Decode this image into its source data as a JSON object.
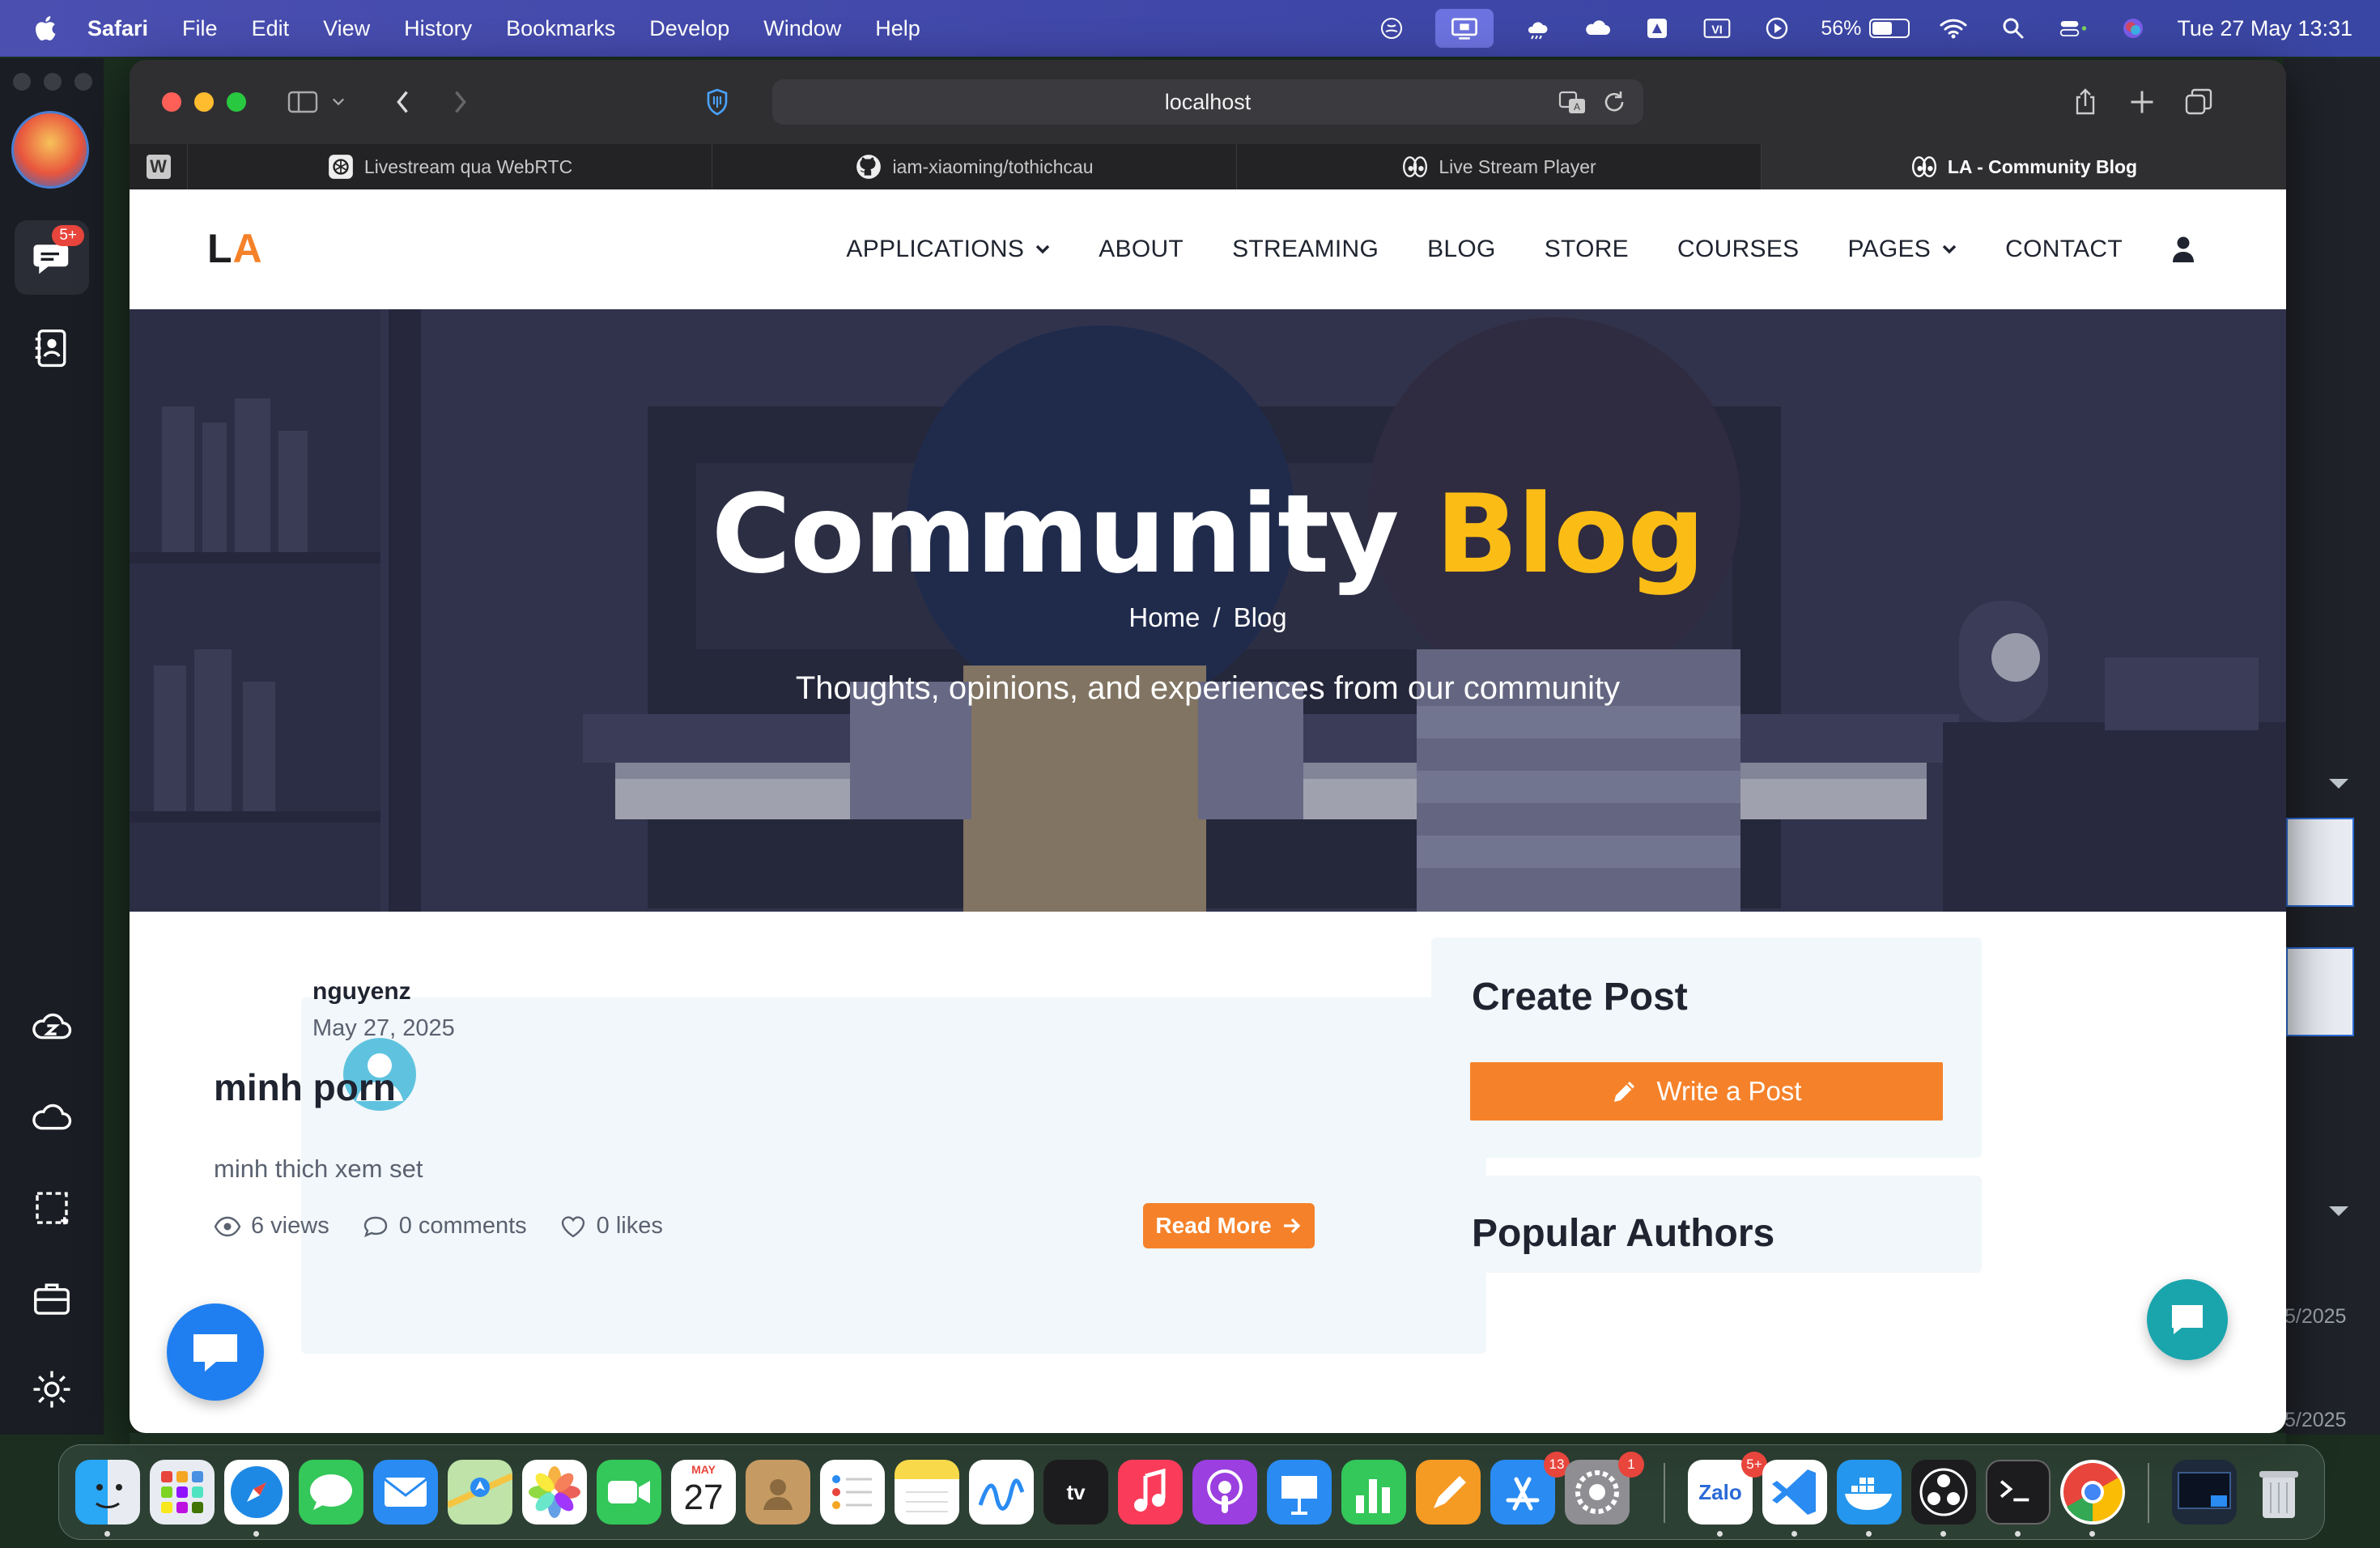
{
  "menubar": {
    "app_name": "Safari",
    "menus": [
      "File",
      "Edit",
      "View",
      "History",
      "Bookmarks",
      "Develop",
      "Window",
      "Help"
    ],
    "battery_percent": "56%",
    "battery_level": 0.56,
    "clock": "Tue 27 May  13:31",
    "status_icons": [
      "perplexity-icon",
      "screen-share-icon",
      "weather-icon",
      "icloud-icon",
      "drive-icon",
      "vietnamese-input-icon",
      "play-icon",
      "wifi-icon",
      "spotlight-icon",
      "control-center-icon",
      "siri-icon"
    ],
    "input_label": "VI"
  },
  "app_rail": {
    "badge": "5+",
    "items": [
      "chat-icon",
      "contacts-icon",
      "cloud-z-icon",
      "cloud-icon",
      "screenshot-icon",
      "briefcase-icon",
      "settings-icon"
    ]
  },
  "right_strip": {
    "dates": [
      "5/2025",
      "5/2025"
    ]
  },
  "browser": {
    "url": "localhost",
    "pinned_tab_label": "W",
    "tabs": [
      {
        "label": "Livestream qua WebRTC",
        "icon": "openai-icon"
      },
      {
        "label": "iam-xiaoming/tothichcau",
        "icon": "github-icon"
      },
      {
        "label": "Live Stream Player",
        "icon": "eyes-icon"
      },
      {
        "label": "LA - Community Blog",
        "icon": "eyes-icon"
      }
    ]
  },
  "site": {
    "logo_l": "L",
    "logo_a": "A",
    "colors": {
      "brand": "#f5822a",
      "accent": "#fbbd15",
      "teal": "#1aa5ad",
      "chat_blue": "#1f7ff0"
    },
    "nav": [
      "APPLICATIONS",
      "ABOUT",
      "STREAMING",
      "BLOG",
      "STORE",
      "COURSES",
      "PAGES",
      "CONTACT"
    ],
    "hero": {
      "title_main": "Community",
      "title_accent": "Blog",
      "breadcrumb_home": "Home",
      "breadcrumb_sep": "/",
      "breadcrumb_current": "Blog",
      "subtitle": "Thoughts, opinions, and experiences from our community"
    },
    "post": {
      "author": "nguyenz",
      "date": "May 27, 2025",
      "title": "minh porn",
      "excerpt": "minh thich xem set",
      "views": "6 views",
      "comments": "0 comments",
      "likes": "0 likes",
      "read_more": "Read More"
    },
    "sidebar": {
      "create_title": "Create Post",
      "write_button": "Write a Post",
      "popular_title": "Popular Authors"
    }
  },
  "dock": {
    "apps": [
      "Finder",
      "Launchpad",
      "Safari",
      "Messages",
      "Mail",
      "Maps",
      "Photos",
      "FaceTime",
      "Calendar",
      "Contacts",
      "Reminders",
      "Notes",
      "Freeform",
      "TV",
      "Music",
      "Podcasts",
      "Keynote",
      "Numbers",
      "Pages",
      "App Store",
      "System Settings",
      "Zalo",
      "VS Code",
      "Docker",
      "OBS",
      "Terminal",
      "Chrome",
      "Preview",
      "Trash"
    ],
    "calendar_month": "MAY",
    "calendar_day": "27",
    "tv_label": "tv",
    "zalo_label": "Zalo",
    "appstore_badge": "13",
    "settings_badge": "1",
    "zalo_badge": "5+"
  }
}
